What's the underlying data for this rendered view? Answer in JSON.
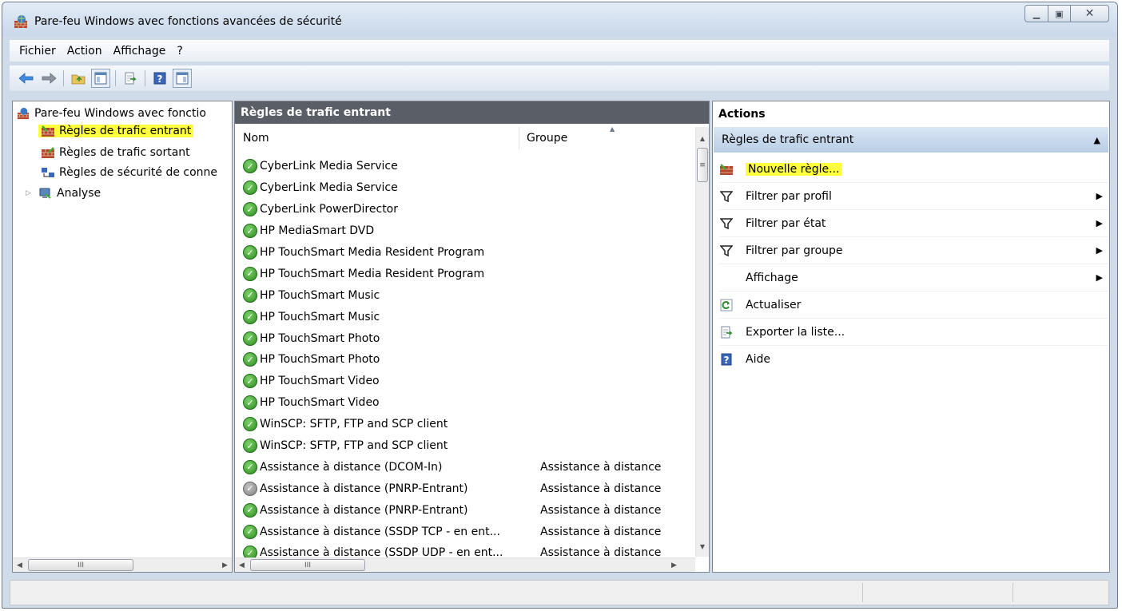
{
  "window": {
    "title": "Pare-feu Windows avec fonctions avancées de sécurité"
  },
  "menu": [
    "Fichier",
    "Action",
    "Affichage",
    "?"
  ],
  "tree": {
    "root": "Pare-feu Windows avec fonctio",
    "items": [
      {
        "label": "Règles de trafic entrant",
        "selected": true
      },
      {
        "label": "Règles de trafic sortant"
      },
      {
        "label": "Règles de sécurité de conne"
      },
      {
        "label": "Analyse"
      }
    ]
  },
  "list": {
    "header": "Règles de trafic entrant",
    "columns": {
      "name": "Nom",
      "group": "Groupe"
    },
    "rows": [
      {
        "name": "CyberLink Media Service",
        "group": "",
        "enabled": true
      },
      {
        "name": "CyberLink Media Service",
        "group": "",
        "enabled": true
      },
      {
        "name": "CyberLink PowerDirector",
        "group": "",
        "enabled": true
      },
      {
        "name": "HP MediaSmart DVD",
        "group": "",
        "enabled": true
      },
      {
        "name": "HP TouchSmart Media Resident Program",
        "group": "",
        "enabled": true
      },
      {
        "name": "HP TouchSmart Media Resident Program",
        "group": "",
        "enabled": true
      },
      {
        "name": "HP TouchSmart Music",
        "group": "",
        "enabled": true
      },
      {
        "name": "HP TouchSmart Music",
        "group": "",
        "enabled": true
      },
      {
        "name": "HP TouchSmart Photo",
        "group": "",
        "enabled": true
      },
      {
        "name": "HP TouchSmart Photo",
        "group": "",
        "enabled": true
      },
      {
        "name": "HP TouchSmart Video",
        "group": "",
        "enabled": true
      },
      {
        "name": "HP TouchSmart Video",
        "group": "",
        "enabled": true
      },
      {
        "name": "WinSCP: SFTP, FTP and SCP client",
        "group": "",
        "enabled": true
      },
      {
        "name": "WinSCP: SFTP, FTP and SCP client",
        "group": "",
        "enabled": true
      },
      {
        "name": "Assistance à distance (DCOM-In)",
        "group": "Assistance à distance",
        "enabled": true
      },
      {
        "name": "Assistance à distance (PNRP-Entrant)",
        "group": "Assistance à distance",
        "enabled": false
      },
      {
        "name": "Assistance à distance (PNRP-Entrant)",
        "group": "Assistance à distance",
        "enabled": true
      },
      {
        "name": "Assistance à distance (SSDP TCP - en ent...",
        "group": "Assistance à distance",
        "enabled": true
      },
      {
        "name": "Assistance à distance (SSDP UDP - en ent...",
        "group": "Assistance à distance",
        "enabled": true
      }
    ]
  },
  "actions": {
    "title": "Actions",
    "section": "Règles de trafic entrant",
    "items": [
      {
        "label": "Nouvelle règle...",
        "icon": "new-rule-icon",
        "highlight": true
      },
      {
        "label": "Filtrer par profil",
        "icon": "filter-icon",
        "submenu": true
      },
      {
        "label": "Filtrer par état",
        "icon": "filter-icon",
        "submenu": true
      },
      {
        "label": "Filtrer par groupe",
        "icon": "filter-icon",
        "submenu": true
      },
      {
        "label": "Affichage",
        "icon": "",
        "submenu": true
      },
      {
        "label": "Actualiser",
        "icon": "refresh-icon"
      },
      {
        "label": "Exporter la liste...",
        "icon": "export-icon"
      },
      {
        "label": "Aide",
        "icon": "help-icon"
      }
    ]
  },
  "colors": {
    "highlight": "#ffff3c",
    "header_bg": "#5a5e66",
    "section_bg": "#c9d9ec"
  }
}
